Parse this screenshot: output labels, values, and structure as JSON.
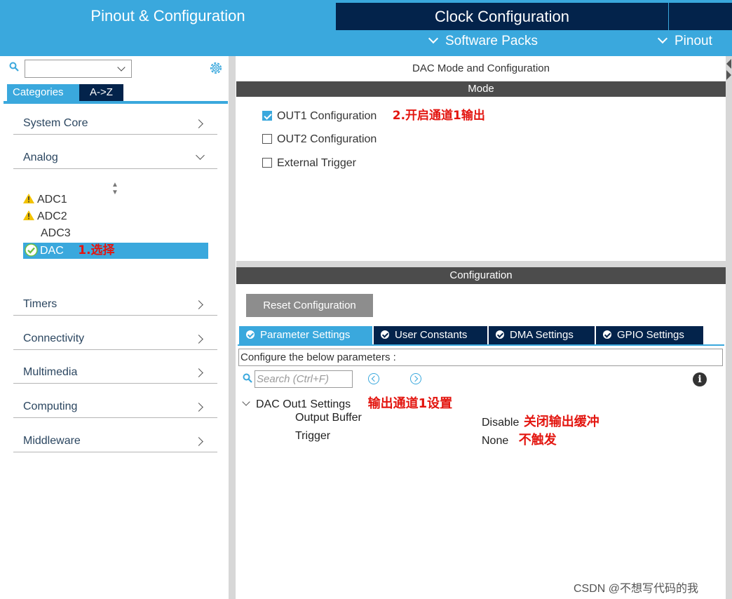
{
  "header": {
    "tab_pinout": "Pinout & Configuration",
    "tab_clock": "Clock Configuration",
    "menu_software_packs": "Software Packs",
    "menu_pinout": "Pinout"
  },
  "left": {
    "search_value": "",
    "tabs": {
      "categories": "Categories",
      "az": "A->Z"
    },
    "categories": [
      {
        "label": "System Core"
      },
      {
        "label": "Analog"
      },
      {
        "label": "Timers"
      },
      {
        "label": "Connectivity"
      },
      {
        "label": "Multimedia"
      },
      {
        "label": "Computing"
      },
      {
        "label": "Middleware"
      }
    ],
    "analog_items": [
      {
        "label": "ADC1",
        "status": "warning"
      },
      {
        "label": "ADC2",
        "status": "warning"
      },
      {
        "label": "ADC3",
        "status": "none"
      },
      {
        "label": "DAC",
        "status": "ok"
      }
    ]
  },
  "mode": {
    "title": "DAC Mode and Configuration",
    "bar": "Mode",
    "checkboxes": [
      {
        "label": "OUT1 Configuration",
        "checked": true
      },
      {
        "label": "OUT2 Configuration",
        "checked": false
      },
      {
        "label": "External Trigger",
        "checked": false
      }
    ]
  },
  "config": {
    "bar": "Configuration",
    "reset_label": "Reset Configuration",
    "tabs": [
      {
        "label": "Parameter Settings",
        "active": true
      },
      {
        "label": "User Constants",
        "active": false
      },
      {
        "label": "DMA Settings",
        "active": false
      },
      {
        "label": "GPIO Settings",
        "active": false
      }
    ],
    "param_caption": "Configure the below parameters :",
    "search_placeholder": "Search (Ctrl+F)",
    "group_label": "DAC Out1 Settings",
    "params": [
      {
        "name": "Output Buffer",
        "value": "Disable"
      },
      {
        "name": "Trigger",
        "value": "None"
      }
    ]
  },
  "annotations": {
    "select": "1.选择",
    "enable_out1": "2.开启通道1输出",
    "out1_settings": "输出通道1设置",
    "disable_buffer": "关闭输出缓冲",
    "no_trigger": "不触发"
  },
  "watermark": "CSDN @不想写代码的我",
  "colors": {
    "accent": "#3aa8dd",
    "dark_navy": "#03234b",
    "bar_gray": "#4c4c4c",
    "annotation_red": "#e3150f"
  }
}
